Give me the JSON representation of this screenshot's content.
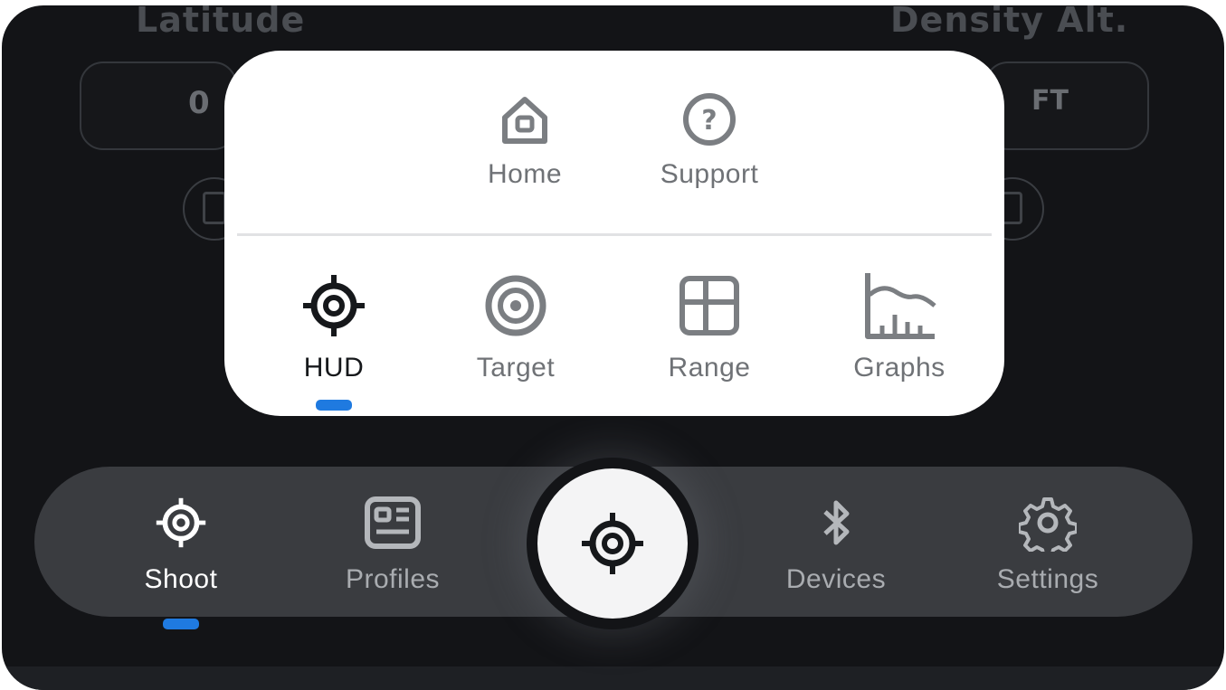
{
  "background": {
    "left_label": "Latitude",
    "right_label": "Density Alt.",
    "left_value": "0",
    "right_unit": "FT"
  },
  "popup": {
    "top_items": [
      {
        "label": "Home",
        "icon": "home-icon"
      },
      {
        "label": "Support",
        "icon": "question-circle-icon"
      }
    ],
    "bottom_items": [
      {
        "label": "HUD",
        "icon": "crosshair-icon",
        "active": true
      },
      {
        "label": "Target",
        "icon": "target-icon"
      },
      {
        "label": "Range",
        "icon": "table-grid-icon"
      },
      {
        "label": "Graphs",
        "icon": "graph-icon"
      }
    ]
  },
  "navbar": {
    "items": [
      {
        "label": "Shoot",
        "icon": "crosshair-icon",
        "active": true
      },
      {
        "label": "Profiles",
        "icon": "id-card-icon"
      },
      {
        "label": "Devices",
        "icon": "bluetooth-icon"
      },
      {
        "label": "Settings",
        "icon": "gear-icon"
      }
    ],
    "center_icon": "crosshair-icon"
  },
  "colors": {
    "accent": "#1f7ae0",
    "background": "#131417",
    "navbar": "#3a3c40",
    "popup": "#ffffff"
  }
}
